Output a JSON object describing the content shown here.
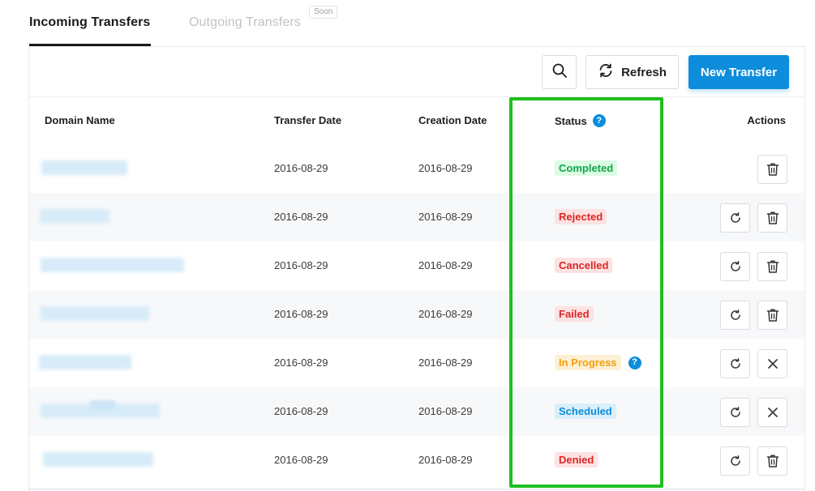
{
  "tabs": {
    "incoming": "Incoming Transfers",
    "outgoing": "Outgoing Transfers",
    "soon_badge": "Soon"
  },
  "toolbar": {
    "search_icon": "search-icon",
    "refresh_label": "Refresh",
    "refresh_icon": "refresh-icon",
    "new_transfer_label": "New Transfer"
  },
  "table": {
    "columns": {
      "domain": "Domain Name",
      "transfer_date": "Transfer Date",
      "creation_date": "Creation Date",
      "status": "Status",
      "actions": "Actions"
    },
    "status_help": "?",
    "rows": [
      {
        "domain": "",
        "transfer_date": "2016-08-29",
        "creation_date": "2016-08-29",
        "status": "Completed",
        "status_color": "#16a34a",
        "status_bg": "#dcfce4",
        "actions": [
          "delete"
        ]
      },
      {
        "domain": "",
        "transfer_date": "2016-08-29",
        "creation_date": "2016-08-29",
        "status": "Rejected",
        "status_color": "#dc2626",
        "status_bg": "#fde2e2",
        "actions": [
          "retry",
          "delete"
        ]
      },
      {
        "domain": "",
        "transfer_date": "2016-08-29",
        "creation_date": "2016-08-29",
        "status": "Cancelled",
        "status_color": "#dc2626",
        "status_bg": "#fde2e2",
        "actions": [
          "retry",
          "delete"
        ]
      },
      {
        "domain": "",
        "transfer_date": "2016-08-29",
        "creation_date": "2016-08-29",
        "status": "Failed",
        "status_color": "#dc2626",
        "status_bg": "#fde2e2",
        "actions": [
          "retry",
          "delete"
        ]
      },
      {
        "domain": "",
        "transfer_date": "2016-08-29",
        "creation_date": "2016-08-29",
        "status": "In Progress",
        "status_color": "#f59e0b",
        "status_bg": "#fdf0d5",
        "status_help": "?",
        "actions": [
          "retry",
          "cancel"
        ]
      },
      {
        "domain": "",
        "transfer_date": "2016-08-29",
        "creation_date": "2016-08-29",
        "status": "Scheduled",
        "status_color": "#0d8ddb",
        "status_bg": "#dbeffb",
        "actions": [
          "retry",
          "cancel"
        ]
      },
      {
        "domain": "",
        "transfer_date": "2016-08-29",
        "creation_date": "2016-08-29",
        "status": "Denied",
        "status_color": "#dc2626",
        "status_bg": "#fde2e2",
        "actions": [
          "retry",
          "delete"
        ]
      }
    ]
  },
  "colors": {
    "accent": "#0d8ddb",
    "highlight": "#1fbf1f"
  }
}
